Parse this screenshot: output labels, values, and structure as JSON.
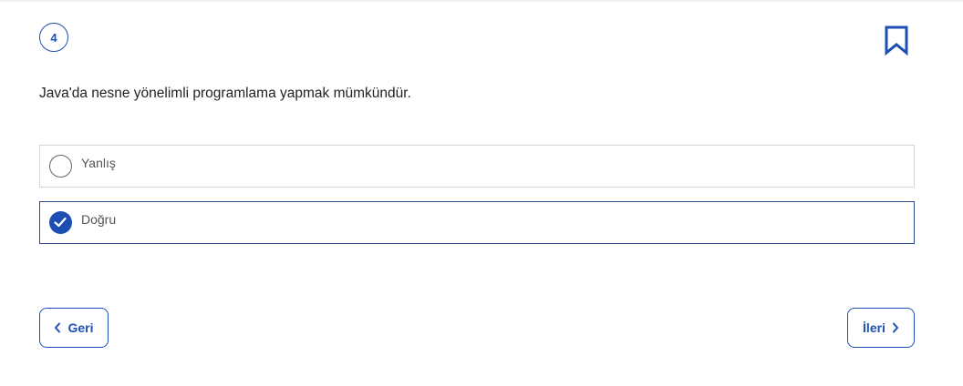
{
  "question": {
    "number": "4",
    "text": "Java'da nesne yönelimli programlama yapmak mümkündür."
  },
  "options": [
    {
      "label": "Yanlış",
      "selected": false
    },
    {
      "label": "Doğru",
      "selected": true
    }
  ],
  "navigation": {
    "back_label": "Geri",
    "next_label": "İleri"
  },
  "icons": {
    "bookmark": "bookmark-icon",
    "check": "check-icon",
    "back": "chevron-left-icon",
    "next": "chevron-right-icon"
  },
  "colors": {
    "accent": "#1d4fb3",
    "selected_border": "#2d4f8e"
  }
}
